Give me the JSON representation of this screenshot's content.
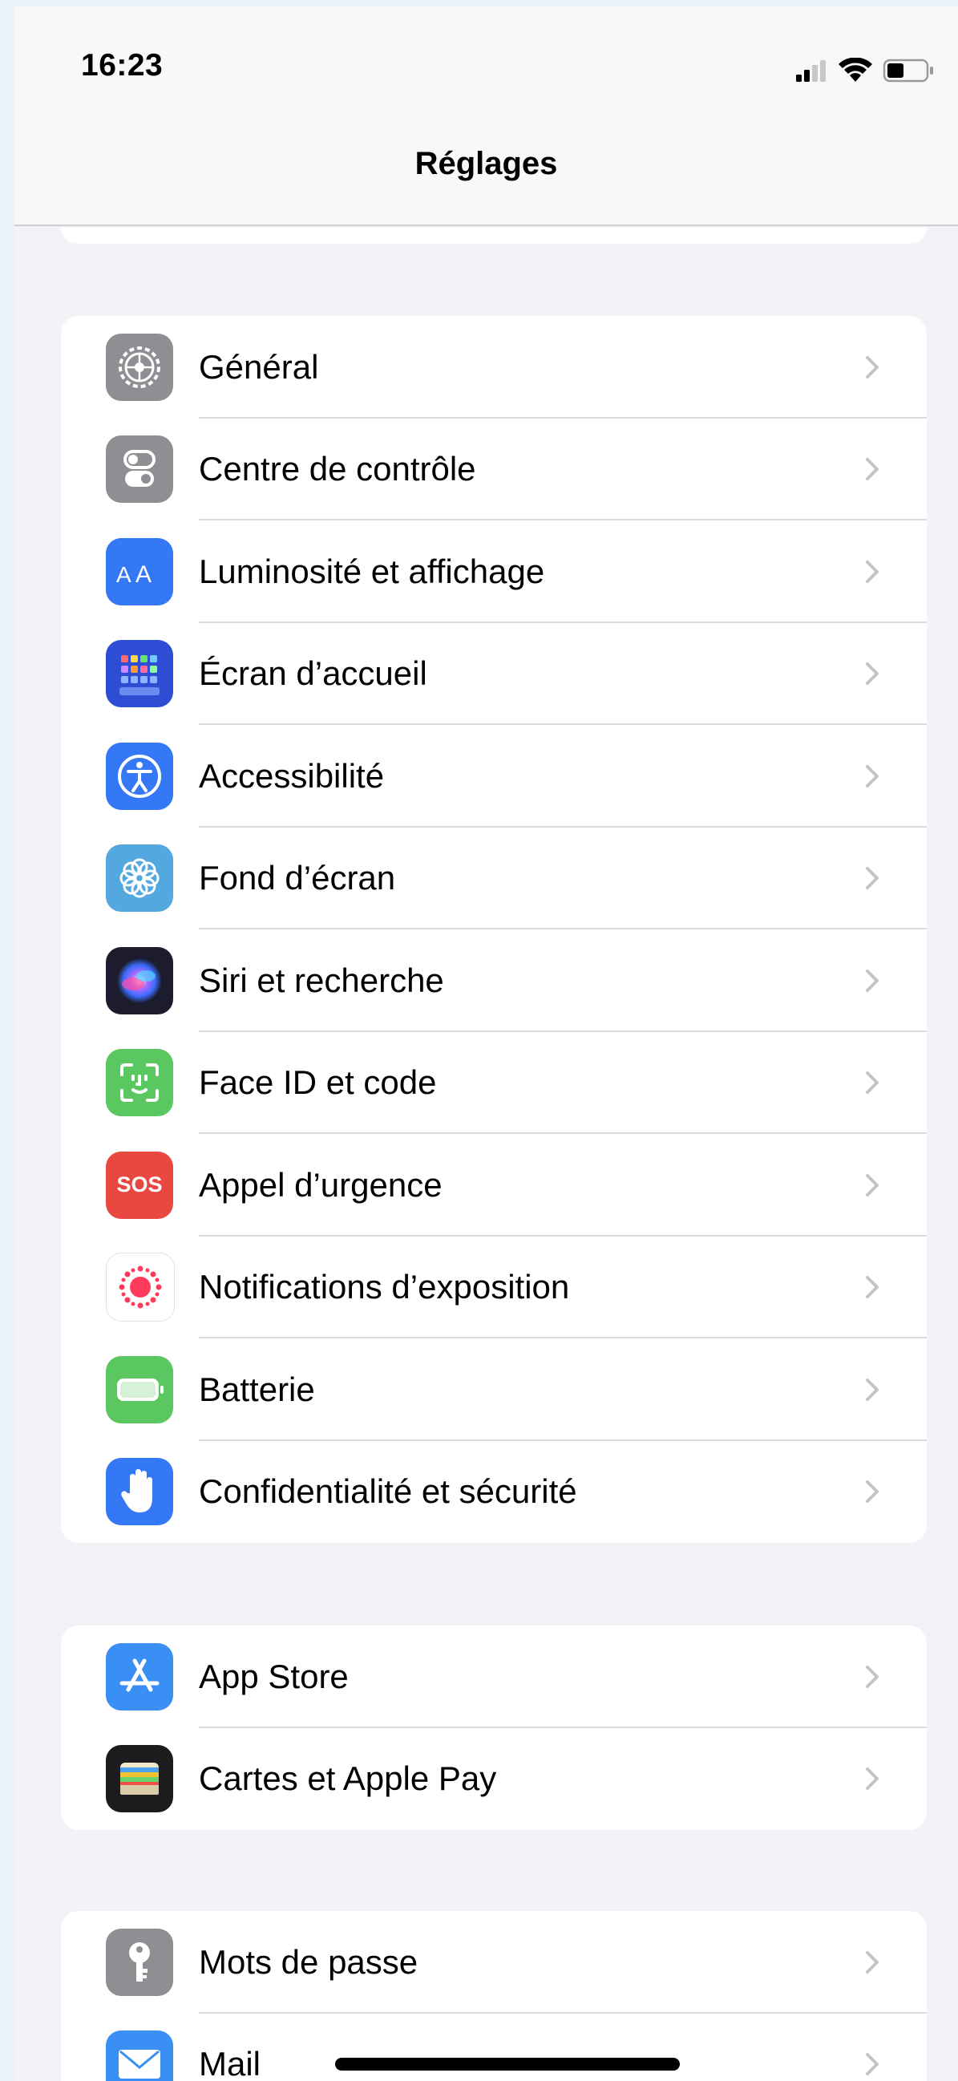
{
  "status_bar": {
    "time": "16:23"
  },
  "nav": {
    "title": "Réglages"
  },
  "groups": [
    {
      "items": [
        {
          "label": "Général",
          "icon": "gear-icon",
          "color": "#8e8e93"
        },
        {
          "label": "Centre de contrôle",
          "icon": "toggles-icon",
          "color": "#8e8e93"
        },
        {
          "label": "Luminosité et affichage",
          "icon": "aa-text-icon",
          "color": "#3478f6"
        },
        {
          "label": "Écran d’accueil",
          "icon": "home-grid-icon",
          "color": "#2c4dd4"
        },
        {
          "label": "Accessibilité",
          "icon": "accessibility-icon",
          "color": "#3478f6"
        },
        {
          "label": "Fond d’écran",
          "icon": "wallpaper-flower-icon",
          "color": "#54a8e0"
        },
        {
          "label": "Siri et recherche",
          "icon": "siri-icon",
          "color": "#1c1c2e"
        },
        {
          "label": "Face ID et code",
          "icon": "face-id-icon",
          "color": "#5bc760"
        },
        {
          "label": "Appel d’urgence",
          "icon": "sos-icon",
          "icon_text": "SOS",
          "color": "#e8483f"
        },
        {
          "label": "Notifications d’exposition",
          "icon": "exposure-icon",
          "color": "#ffffff"
        },
        {
          "label": "Batterie",
          "icon": "battery-icon",
          "color": "#5bc760"
        },
        {
          "label": "Confidentialité et sécurité",
          "icon": "hand-icon",
          "color": "#3478f6"
        }
      ]
    },
    {
      "items": [
        {
          "label": "App Store",
          "icon": "app-store-icon",
          "color": "#3a8ff5"
        },
        {
          "label": "Cartes et Apple Pay",
          "icon": "wallet-icon",
          "color": "#1c1c1e"
        }
      ]
    },
    {
      "items": [
        {
          "label": "Mots de passe",
          "icon": "key-icon",
          "color": "#8e8e93"
        },
        {
          "label": "Mail",
          "icon": "mail-icon",
          "color": "#3a8ff5"
        }
      ]
    }
  ]
}
